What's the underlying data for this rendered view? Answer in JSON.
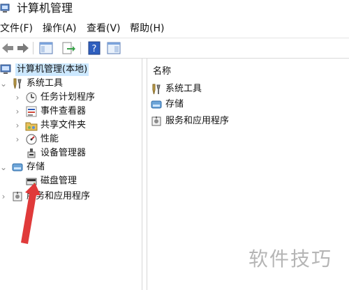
{
  "window": {
    "title": "计算机管理"
  },
  "menu": {
    "items": [
      "文件(F)",
      "操作(A)",
      "查看(V)",
      "帮助(H)"
    ]
  },
  "toolbar": {
    "buttons": [
      {
        "icon": "back-arrow-icon"
      },
      {
        "icon": "forward-arrow-icon"
      },
      {
        "icon": "console-tree-icon"
      },
      {
        "icon": "export-list-icon"
      },
      {
        "icon": "help-icon"
      },
      {
        "icon": "mmc-view-icon"
      }
    ]
  },
  "tree": {
    "root": {
      "label": "计算机管理(本地)"
    },
    "items": [
      {
        "label": "系统工具",
        "icon": "tools-icon"
      },
      {
        "label": "任务计划程序",
        "icon": "clock-icon"
      },
      {
        "label": "事件查看器",
        "icon": "event-viewer-icon"
      },
      {
        "label": "共享文件夹",
        "icon": "shared-folder-icon"
      },
      {
        "label": "性能",
        "icon": "performance-icon"
      },
      {
        "label": "设备管理器",
        "icon": "device-manager-icon"
      },
      {
        "label": "存储",
        "icon": "storage-icon"
      },
      {
        "label": "磁盘管理",
        "icon": "disk-management-icon"
      },
      {
        "label": "服务和应用程序",
        "icon": "services-icon"
      }
    ]
  },
  "list": {
    "header": "名称",
    "items": [
      {
        "label": "系统工具",
        "icon": "tools-icon"
      },
      {
        "label": "存储",
        "icon": "storage-icon"
      },
      {
        "label": "服务和应用程序",
        "icon": "services-icon"
      }
    ]
  },
  "watermark": "软件技巧",
  "colors": {
    "selection": "#cce8ff",
    "arrow": "#e03a3a"
  }
}
